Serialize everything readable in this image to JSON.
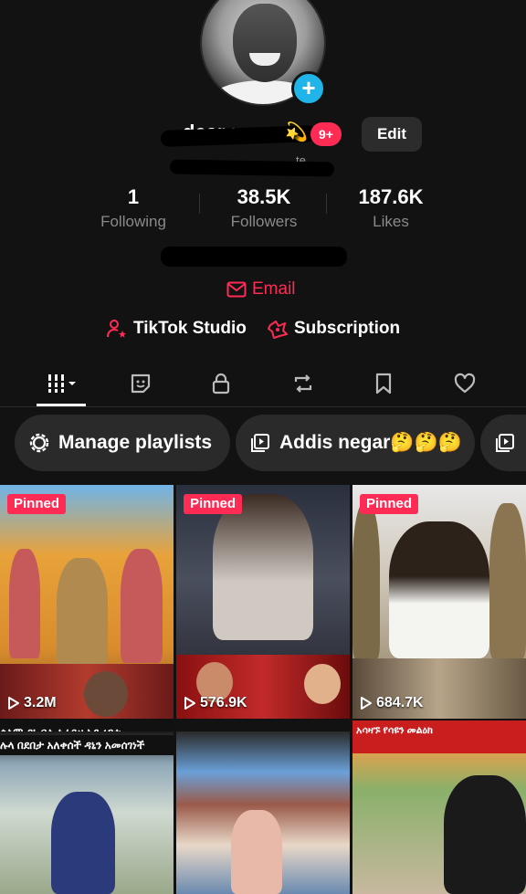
{
  "profile": {
    "username": "dear  m",
    "sparkle": "💫",
    "notification_count": "9+",
    "edit_label": "Edit",
    "bio_fragment": "te"
  },
  "stats": [
    {
      "value": "1",
      "label": "Following"
    },
    {
      "value": "38.5K",
      "label": "Followers"
    },
    {
      "value": "187.6K",
      "label": "Likes"
    }
  ],
  "email_label": "Email",
  "actions": {
    "studio_label": "TikTok Studio",
    "subscription_label": "Subscription"
  },
  "tabs": [
    {
      "icon": "grid-icon",
      "active": true
    },
    {
      "icon": "sticker-icon"
    },
    {
      "icon": "lock-icon"
    },
    {
      "icon": "repost-icon"
    },
    {
      "icon": "bookmark-icon"
    },
    {
      "icon": "heart-icon"
    }
  ],
  "playlists": {
    "manage_label": "Manage playlists",
    "playlist_1": "Addis negar🤔🤔🤔"
  },
  "videos": [
    {
      "pinned": "Pinned",
      "views": "3.2M",
      "caption": "ሰላም ዳኒ በሊ ነራይዘ አድረጋተ"
    },
    {
      "pinned": "Pinned",
      "views": "576.9K",
      "caption": ""
    },
    {
      "pinned": "Pinned",
      "views": "684.7K",
      "caption": ""
    },
    {
      "caption": "ሉላ በደበታ አለቀሰች ዳኒን አመሰገነች"
    },
    {
      "caption": ""
    },
    {
      "caption": "አሳዛኙ የሳዩን መልዕክ"
    }
  ],
  "colors": {
    "background": "#121212",
    "accent": "#fe2c55",
    "chip": "#2a2a2a",
    "plus_badge": "#20b5e8"
  }
}
